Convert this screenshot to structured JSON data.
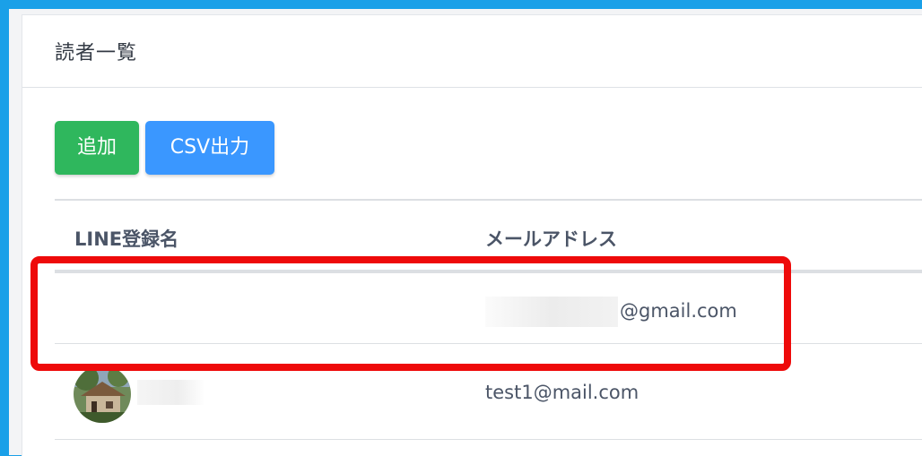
{
  "page": {
    "title": "読者一覧"
  },
  "toolbar": {
    "add_label": "追加",
    "csv_label": "CSV出力"
  },
  "table": {
    "columns": [
      "LINE登録名",
      "メールアドレス"
    ],
    "rows": [
      {
        "line_name": "",
        "email_suffix": "@gmail.com",
        "email_masked": true
      },
      {
        "line_name": "",
        "email": "test1@mail.com",
        "has_avatar": true
      }
    ]
  },
  "colors": {
    "add_button": "#2fb75d",
    "csv_button": "#3a97ff",
    "highlight": "#ee0a0a",
    "outer_border": "#1aa0e8"
  }
}
